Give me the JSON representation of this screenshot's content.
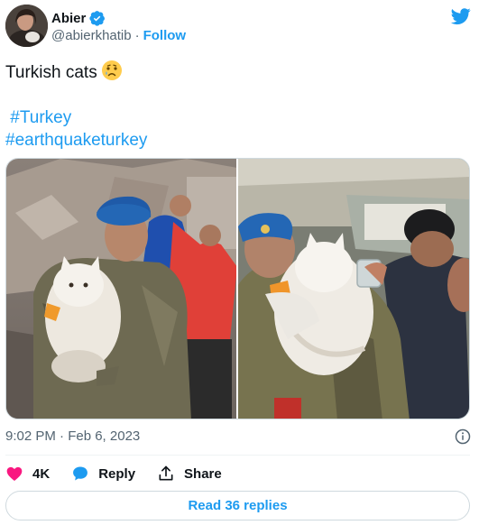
{
  "author": {
    "display_name": "Abier",
    "handle": "@abierkhatib",
    "separator": "·",
    "follow_label": "Follow",
    "verified": true
  },
  "tweet": {
    "text": "Turkish cats",
    "emoji": "cry-face-emoji",
    "hashtags": [
      "#Turkey",
      "#earthquaketurkey"
    ]
  },
  "media": [
    {
      "description_icon": "photo",
      "name": "soldier-holding-cat-photo-1"
    },
    {
      "description_icon": "photo",
      "name": "soldier-holding-cat-photo-2"
    }
  ],
  "meta": {
    "timestamp": "9:02 PM · Feb 6, 2023"
  },
  "actions": {
    "likes": "4K",
    "reply_label": "Reply",
    "share_label": "Share"
  },
  "read_replies_label": "Read 36 replies",
  "colors": {
    "accent": "#1d9bf0",
    "like": "#f91880",
    "secondary_text": "#536471",
    "border": "#cfd9de"
  }
}
